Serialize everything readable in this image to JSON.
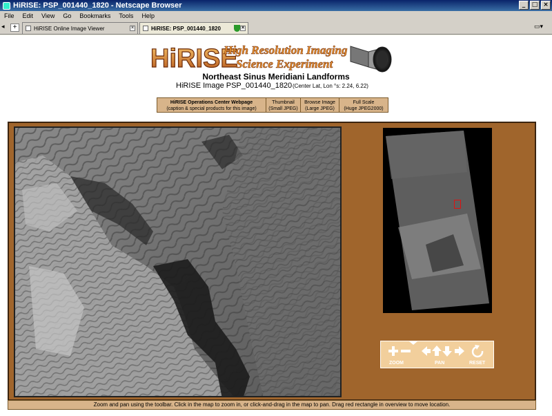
{
  "window": {
    "title": "HiRISE: PSP_001440_1820 - Netscape Browser",
    "min_label": "_",
    "max_label": "□",
    "close_label": "×"
  },
  "menu": [
    "File",
    "Edit",
    "View",
    "Go",
    "Bookmarks",
    "Tools",
    "Help"
  ],
  "tabs": {
    "new_tab_label": "+",
    "items": [
      {
        "label": "HiRISE Online Image Viewer",
        "active": false
      },
      {
        "label": "HiRISE: PSP_001440_1820",
        "active": true
      }
    ]
  },
  "logo": {
    "wordmark": "HiRISE",
    "tagline_line1": "High Resolution Imaging",
    "tagline_line2": "Science Experiment"
  },
  "page": {
    "title": "Northeast Sinus Meridiani Landforms",
    "image_id": "HiRISE Image PSP_001440_1820",
    "latlon": "(Center Lat, Lon °s: 2.24, 6.22)"
  },
  "links": [
    {
      "line1": "HiRISE Operations Center Webpage",
      "line2": "(caption & special products for this image)",
      "bold": true
    },
    {
      "line1": "Thumbnail",
      "line2": "(Small JPEG)",
      "bold": false
    },
    {
      "line1": "Browse Image",
      "line2": "(Large JPEG)",
      "bold": false
    },
    {
      "line1": "Full Scale",
      "line2": "(Huge JPEG2000)",
      "bold": false
    }
  ],
  "toolbar": {
    "zoom_label": "ZOOM",
    "pan_label": "PAN",
    "reset_label": "RESET"
  },
  "help_text": "Zoom and pan using the toolbar.   Click in the map to zoom in, or click-and-drag in the map to pan.   Drag red rectangle in overview to move location.",
  "colors": {
    "viewer_bg": "#a0652c",
    "toolbar_bg": "#f2cf9c",
    "link_bg": "#d8b48a",
    "overview_marker": "#e01010"
  }
}
